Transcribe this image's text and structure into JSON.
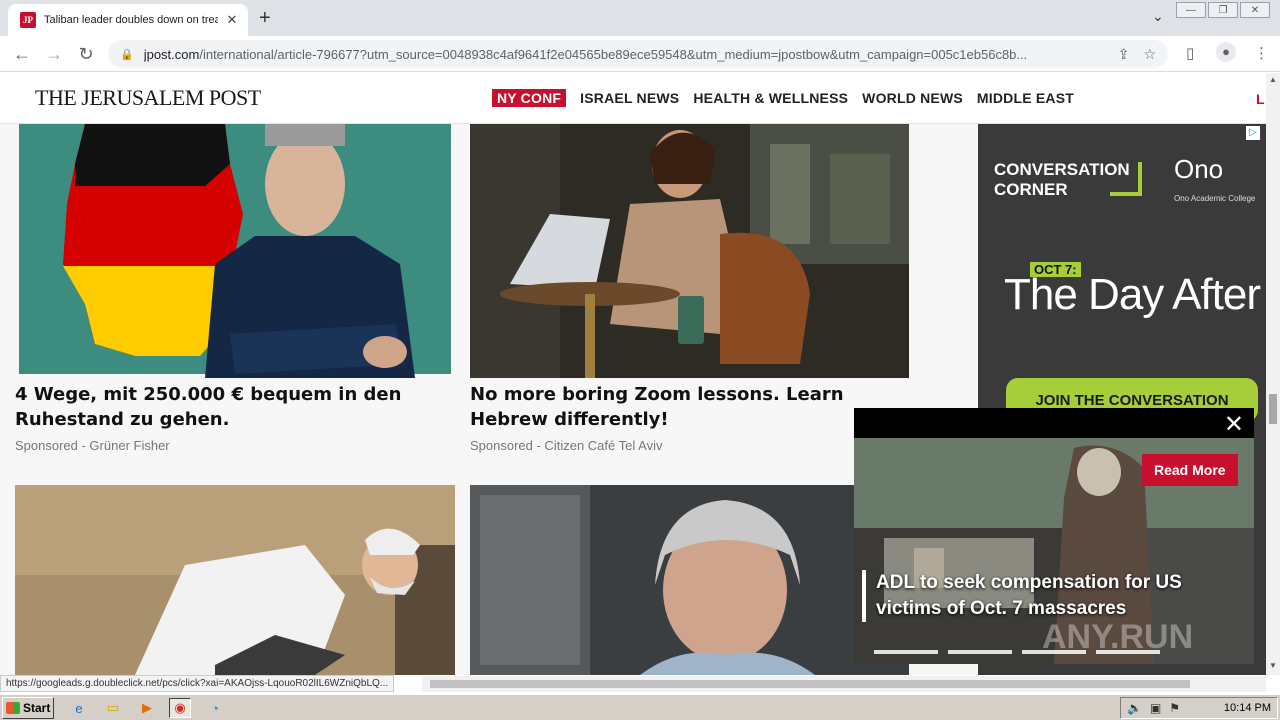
{
  "browser": {
    "tab_title": "Taliban leader doubles down on treat",
    "tab_favicon": "JP",
    "url_domain": "jpost.com",
    "url_path": "/international/article-796677?utm_source=0048938c4af9641f2e04565be89ece59548&utm_medium=jpostbow&utm_campaign=005c1eb56c8b..."
  },
  "site": {
    "logo": "THE JERUSALEM POST",
    "nav": [
      {
        "label": "NY CONF"
      },
      {
        "label": "ISRAEL NEWS"
      },
      {
        "label": "HEALTH & WELLNESS"
      },
      {
        "label": "WORLD NEWS"
      },
      {
        "label": "MIDDLE EAST"
      }
    ],
    "nav_edge": "L"
  },
  "cards": [
    {
      "headline": "4 Wege, mit 250.000 € bequem in den Ruhestand zu gehen.",
      "sponsor": "Sponsored - Grüner Fisher"
    },
    {
      "headline": "No more boring Zoom lessons. Learn Hebrew differently!",
      "sponsor": "Sponsored - Citizen Café Tel Aviv"
    }
  ],
  "ad": {
    "line1": "CONVERSATION",
    "line2": "CORNER",
    "brand": "Ono",
    "brand_sub": "Ono Academic College",
    "tag": "OCT 7:",
    "title": "The Day After",
    "cta": "JOIN THE CONVERSATION"
  },
  "popup": {
    "read_more": "Read More",
    "caption": "ADL to seek compensation for US victims of Oct. 7 massacres",
    "watermark": "ANY.RUN"
  },
  "status_url": "https://googleads.g.doubleclick.net/pcs/click?xai=AKAOjss-LqouoR02lIL6WZniQbLQ...",
  "taskbar": {
    "start": "Start",
    "clock": "10:14 PM"
  },
  "colors": {
    "brand_red": "#c8102e",
    "ad_green": "#a6ce39"
  }
}
